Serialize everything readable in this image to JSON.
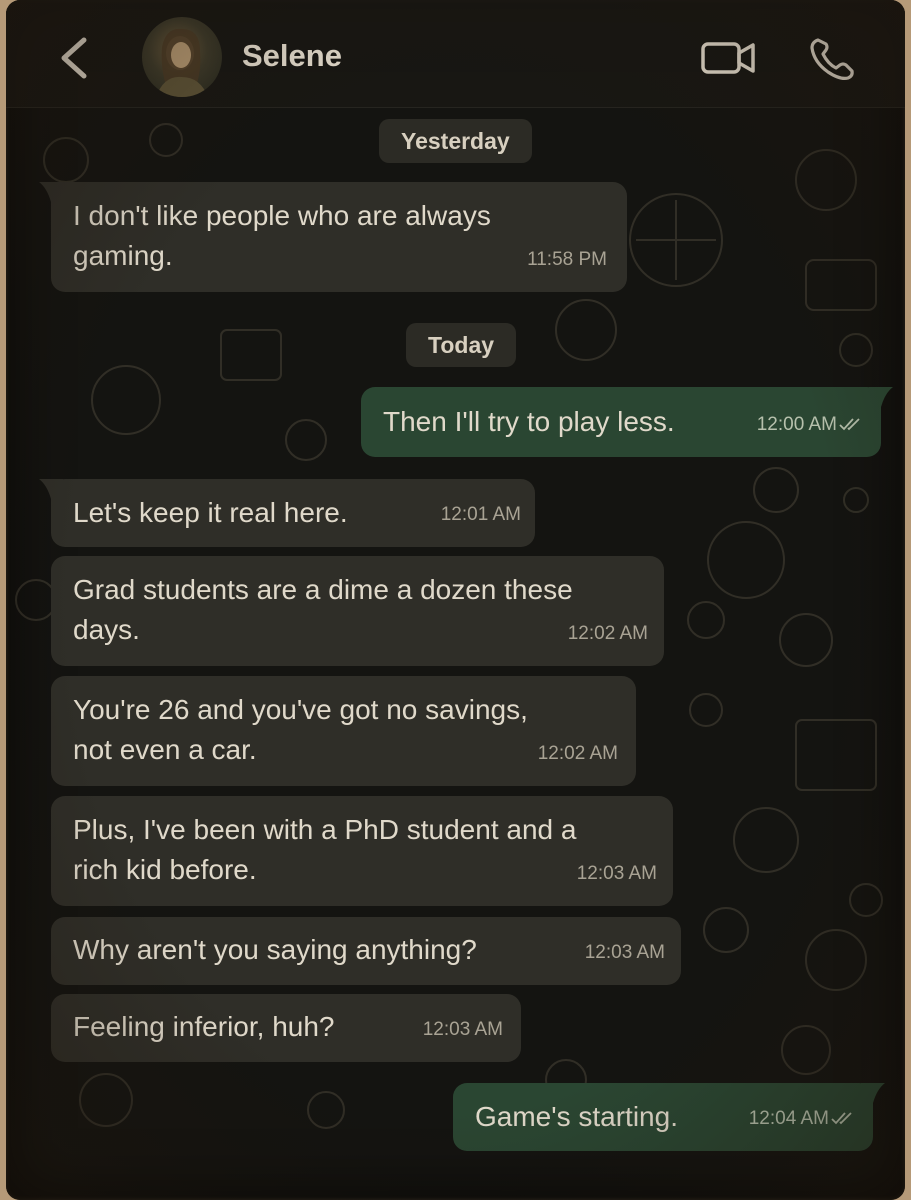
{
  "header": {
    "contact_name": "Selene",
    "back_icon": "chevron-left-icon",
    "video_icon": "video-camera-icon",
    "call_icon": "phone-icon"
  },
  "colors": {
    "incoming_bubble": "#2f2e28",
    "outgoing_bubble": "#2a4632",
    "background": "#141411"
  },
  "dates": {
    "yesterday": "Yesterday",
    "today": "Today"
  },
  "messages": [
    {
      "direction": "in",
      "lines": [
        "I don't like people who are always",
        "gaming."
      ],
      "time": "11:58 PM"
    },
    {
      "direction": "out",
      "lines": [
        "Then I'll try to play less."
      ],
      "time": "12:00 AM",
      "read": true
    },
    {
      "direction": "in",
      "lines": [
        "Let's keep it real here."
      ],
      "time": "12:01 AM"
    },
    {
      "direction": "in",
      "lines": [
        "Grad students are a dime a dozen these",
        "days."
      ],
      "time": "12:02 AM"
    },
    {
      "direction": "in",
      "lines": [
        "You're 26 and you've got no savings,",
        "not even a car."
      ],
      "time": "12:02 AM"
    },
    {
      "direction": "in",
      "lines": [
        "Plus, I've been with a PhD student and a",
        "rich kid before."
      ],
      "time": "12:03 AM"
    },
    {
      "direction": "in",
      "lines": [
        "Why aren't you saying anything?"
      ],
      "time": "12:03 AM"
    },
    {
      "direction": "in",
      "lines": [
        "Feeling inferior, huh?"
      ],
      "time": "12:03 AM"
    },
    {
      "direction": "out",
      "lines": [
        "Game's starting."
      ],
      "time": "12:04 AM",
      "read": true
    }
  ]
}
